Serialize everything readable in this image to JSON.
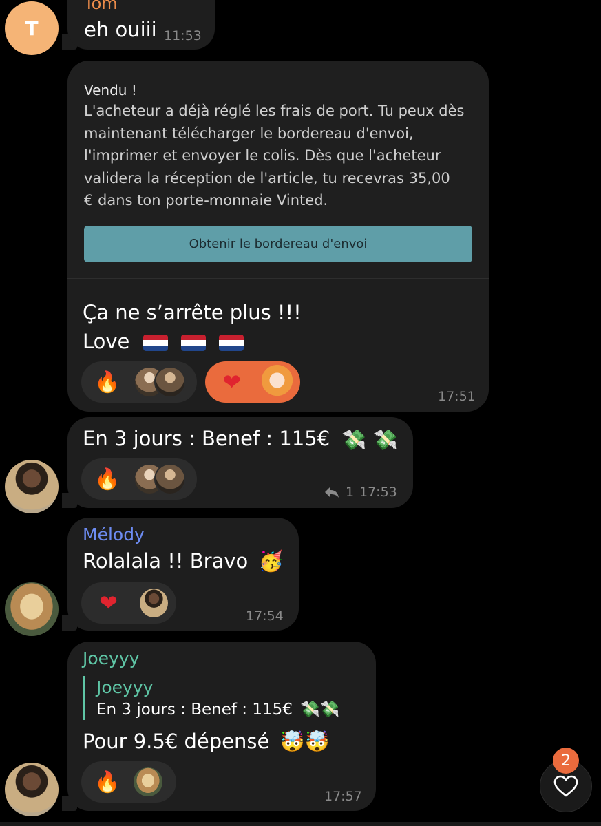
{
  "messages": {
    "tom": {
      "sender": "Tom",
      "avatar_letter": "T",
      "text": "eh ouiii",
      "time": "11:53"
    },
    "vinted": {
      "title": "Vendu !",
      "body_lines": [
        "L'acheteur a déjà réglé les frais de port. Tu peux dès",
        "maintenant télécharger le bordereau d'envoi,",
        "l'imprimer et envoyer le colis. Dès que l'acheteur",
        "validera la réception de l'article, tu recevras 35,00",
        "€ dans ton porte-monnaie Vinted."
      ],
      "button": "Obtenir le bordereau d'envoi",
      "text_line1": "Ça ne s’arrête plus !!!",
      "text_line2": "Love",
      "time": "17:51"
    },
    "benef": {
      "text": "En 3 jours : Benef : 115€",
      "reply_count": "1",
      "time": "17:53"
    },
    "melody": {
      "sender": "Mélody",
      "text": "Rolalala !! Bravo",
      "time": "17:54"
    },
    "joey": {
      "sender": "Joeyyy",
      "quote_sender": "Joeyyy",
      "quote_text": "En 3 jours : Benef : 115€",
      "text": "Pour 9.5€ dépensé",
      "time": "17:57"
    }
  },
  "reactions_button": {
    "badge": "2"
  },
  "colors": {
    "bubble": "#1e1e1e",
    "accent_orange": "#ea6b3d",
    "button_teal": "#5f9ea8",
    "sender_melody": "#6d8cf2",
    "sender_joey": "#5fc6a6",
    "sender_tom": "#ea8b4a"
  },
  "icons": [
    "fire-icon",
    "heart-icon",
    "party-face-icon",
    "exploding-head-icon",
    "money-wings-icon",
    "netherlands-flag-icon",
    "reply-arrow-icon"
  ]
}
